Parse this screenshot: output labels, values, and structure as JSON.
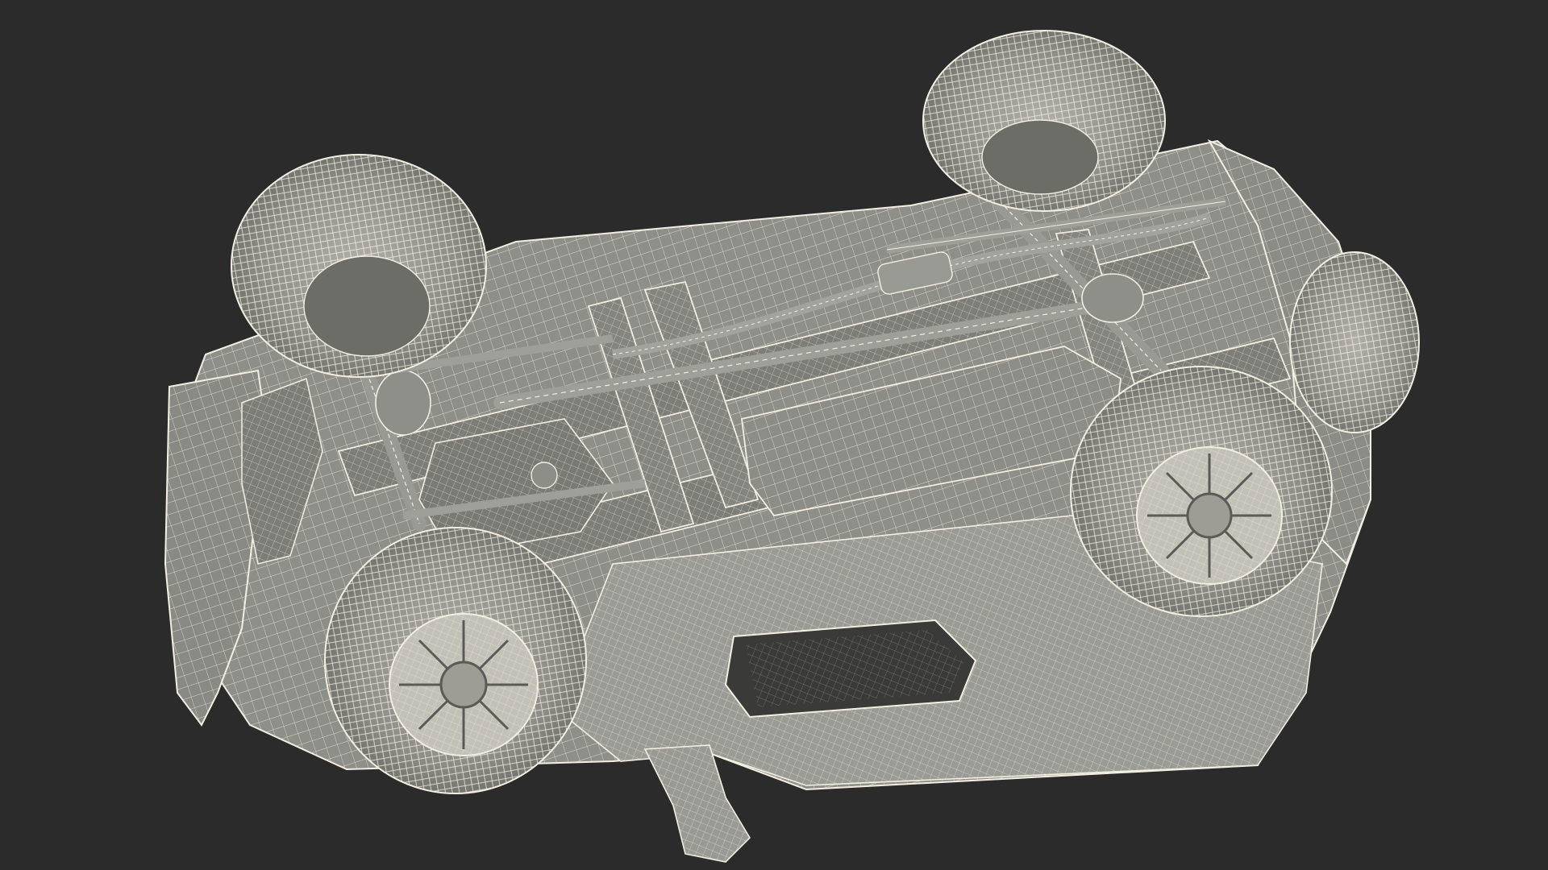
{
  "scene": {
    "subject": "car-underside-wireframe-render",
    "colors": {
      "background": "#2b2b2b",
      "body": "#9a9a94",
      "body_dark": "#6e6e69",
      "wire": "#f2efe2",
      "shadow": "#1c1c1c"
    }
  }
}
